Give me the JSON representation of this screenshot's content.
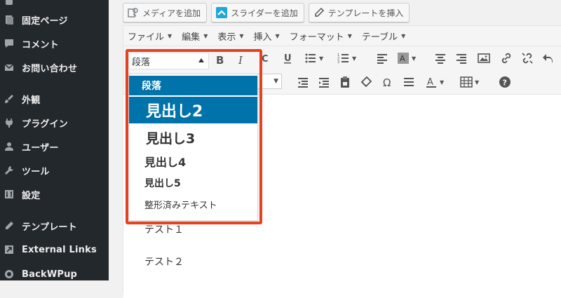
{
  "sidebar": {
    "items": [
      {
        "label": "",
        "icon": "partial-icon"
      },
      {
        "label": "固定ページ",
        "icon": "page-icon"
      },
      {
        "label": "コメント",
        "icon": "comment-icon"
      },
      {
        "label": "お問い合わせ",
        "icon": "mail-icon"
      },
      {
        "label": "外観",
        "icon": "brush-icon"
      },
      {
        "label": "プラグイン",
        "icon": "plugin-icon"
      },
      {
        "label": "ユーザー",
        "icon": "user-icon"
      },
      {
        "label": "ツール",
        "icon": "wrench-icon"
      },
      {
        "label": "設定",
        "icon": "settings-icon"
      },
      {
        "label": "テンプレート",
        "icon": "pencil-icon"
      },
      {
        "label": "External Links",
        "icon": "external-link-icon"
      },
      {
        "label": "BackWPup",
        "icon": "backwpup-icon"
      }
    ]
  },
  "media_buttons": {
    "add_media": "メディアを追加",
    "add_slider": "スライダーを追加",
    "insert_template": "テンプレートを挿入"
  },
  "menubar": {
    "items": [
      "ファイル",
      "編集",
      "表示",
      "挿入",
      "フォーマット",
      "テーブル"
    ]
  },
  "format_dropdown": {
    "current": "段落",
    "bold_label": "B",
    "italic_label": "I",
    "options": [
      "段落",
      "見出し2",
      "見出し3",
      "見出し4",
      "見出し5",
      "整形済みテキスト"
    ]
  },
  "content": {
    "paragraphs": [
      "テスト１",
      "テスト２"
    ]
  },
  "colors": {
    "sidebar_bg": "#23282d",
    "accent": "#0073aa",
    "highlight": "#e8411f"
  }
}
